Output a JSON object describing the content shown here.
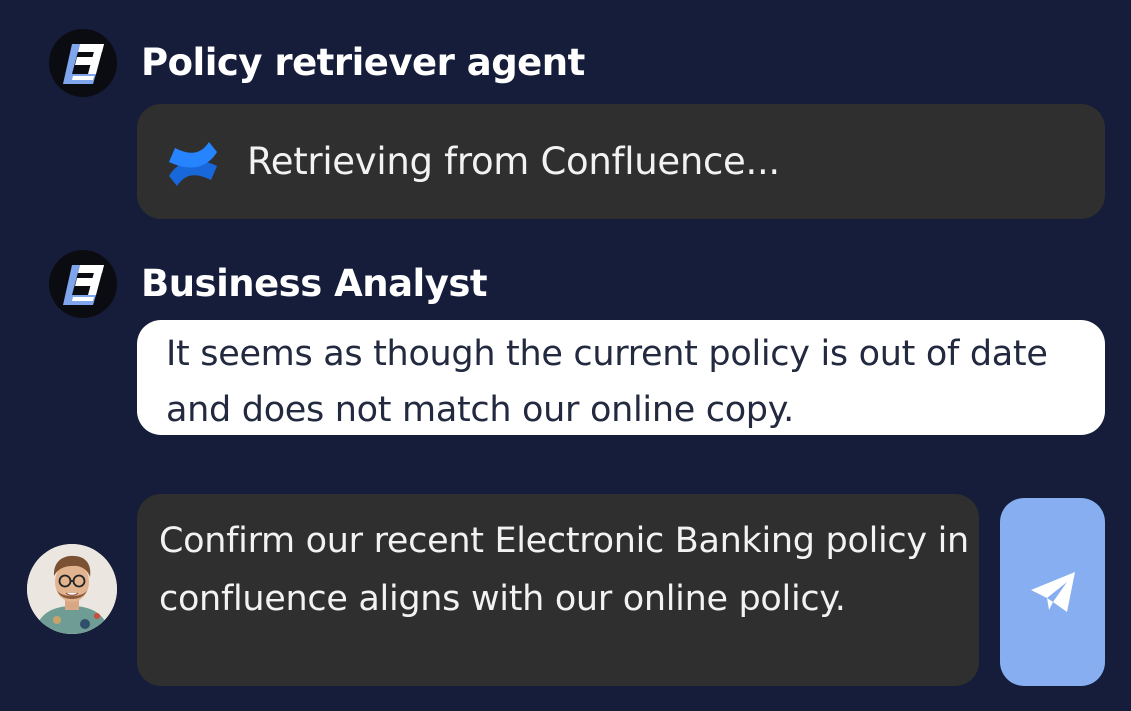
{
  "colors": {
    "background": "#161d3a",
    "dark_bubble": "#2f2f2f",
    "light_bubble": "#ffffff",
    "send_button": "#86aef1",
    "confluence_blue": "#1868db"
  },
  "messages": [
    {
      "sender": "Policy retriever agent",
      "avatar_icon": "lumen-logo-icon",
      "status_icon": "confluence-icon",
      "text": "Retrieving from Confluence..."
    },
    {
      "sender": "Business Analyst",
      "avatar_icon": "lumen-logo-icon",
      "text": "It seems as though the current policy is out of date and does not match our online copy."
    }
  ],
  "composer": {
    "value": "Confirm our recent Electronic Banking policy in confluence aligns with our online policy.",
    "user_avatar": "user-avatar-photo",
    "send_icon": "send-icon"
  }
}
